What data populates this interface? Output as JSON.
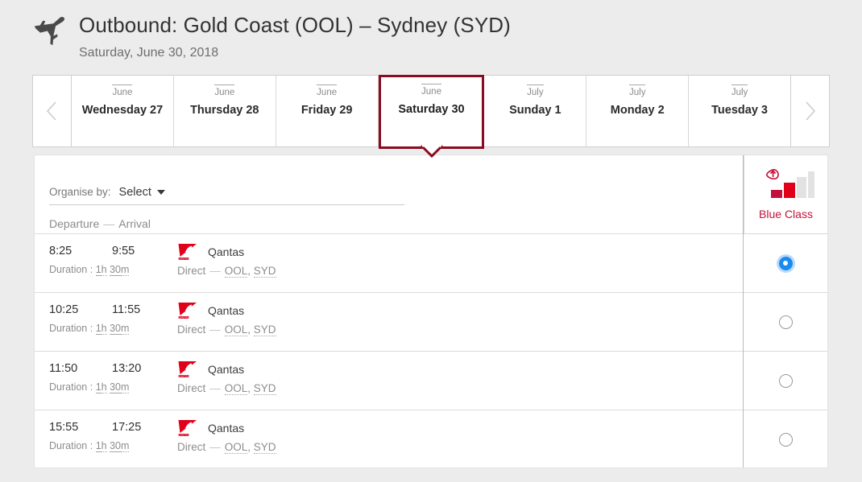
{
  "header": {
    "icon": "airplane-icon",
    "title": "Outbound: Gold Coast (OOL) – Sydney (SYD)",
    "subtitle": "Saturday, June 30, 2018"
  },
  "date_strip": {
    "prev_icon": "chevron-left-icon",
    "next_icon": "chevron-right-icon",
    "dates": [
      {
        "month": "June",
        "day": "Wednesday 27",
        "selected": false
      },
      {
        "month": "June",
        "day": "Thursday 28",
        "selected": false
      },
      {
        "month": "June",
        "day": "Friday 29",
        "selected": false
      },
      {
        "month": "June",
        "day": "Saturday 30",
        "selected": true
      },
      {
        "month": "July",
        "day": "Sunday 1",
        "selected": false
      },
      {
        "month": "July",
        "day": "Monday 2",
        "selected": false
      },
      {
        "month": "July",
        "day": "Tuesday 3",
        "selected": false
      }
    ]
  },
  "controls": {
    "organise_label": "Organise by:",
    "select_value": "Select",
    "caret_icon": "chevron-down-icon",
    "sort_departure": "Departure",
    "sort_dash": "—",
    "sort_arrival": "Arrival"
  },
  "class_column": {
    "icon": "fare-bars-upgrade-icon",
    "label": "Blue Class",
    "label_color": "#c2113a"
  },
  "flights": [
    {
      "departure": "8:25",
      "arrival": "9:55",
      "duration_prefix": "Duration :",
      "duration_hours": "1",
      "duration_hours_unit": "h",
      "duration_minutes": "30",
      "duration_minutes_unit": "m",
      "carrier": "Qantas",
      "carrier_logo": "qantas-logo",
      "stops": "Direct",
      "route_dash": "—",
      "origin": "OOL",
      "destination": "SYD",
      "selected": true
    },
    {
      "departure": "10:25",
      "arrival": "11:55",
      "duration_prefix": "Duration :",
      "duration_hours": "1",
      "duration_hours_unit": "h",
      "duration_minutes": "30",
      "duration_minutes_unit": "m",
      "carrier": "Qantas",
      "carrier_logo": "qantas-logo",
      "stops": "Direct",
      "route_dash": "—",
      "origin": "OOL",
      "destination": "SYD",
      "selected": false
    },
    {
      "departure": "11:50",
      "arrival": "13:20",
      "duration_prefix": "Duration :",
      "duration_hours": "1",
      "duration_hours_unit": "h",
      "duration_minutes": "30",
      "duration_minutes_unit": "m",
      "carrier": "Qantas",
      "carrier_logo": "qantas-logo",
      "stops": "Direct",
      "route_dash": "—",
      "origin": "OOL",
      "destination": "SYD",
      "selected": false
    },
    {
      "departure": "15:55",
      "arrival": "17:25",
      "duration_prefix": "Duration :",
      "duration_hours": "1",
      "duration_hours_unit": "h",
      "duration_minutes": "30",
      "duration_minutes_unit": "m",
      "carrier": "Qantas",
      "carrier_logo": "qantas-logo",
      "stops": "Direct",
      "route_dash": "—",
      "origin": "OOL",
      "destination": "SYD",
      "selected": false
    }
  ],
  "colors": {
    "selected_tab_border": "#8c0b20",
    "brand_red": "#e1001a",
    "radio_blue": "#1a8cf0",
    "page_background": "#ececec"
  }
}
